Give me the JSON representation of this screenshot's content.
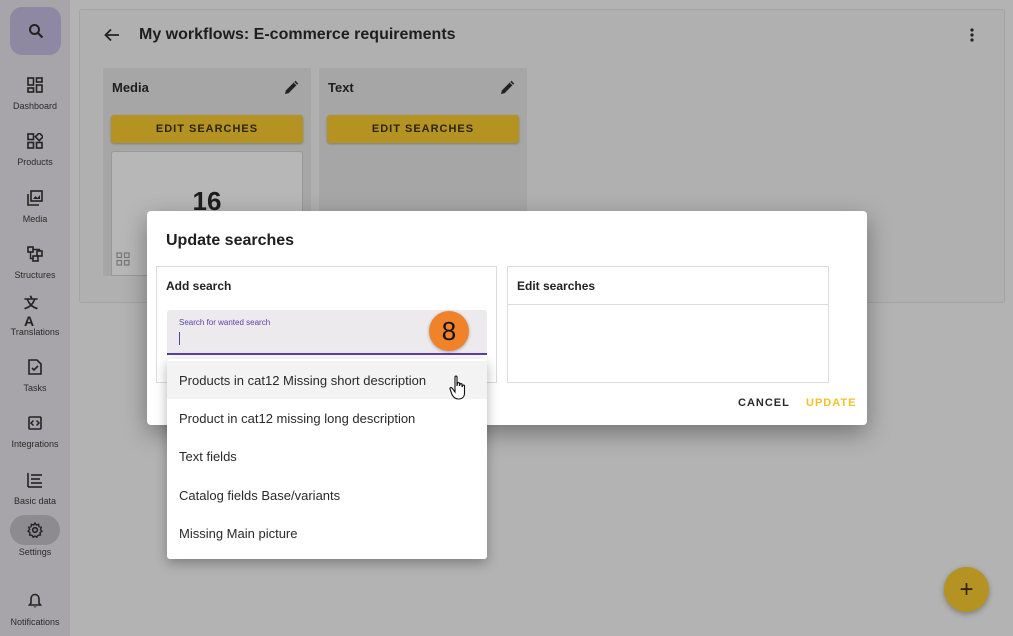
{
  "sidebar": {
    "items": [
      {
        "label": "Dashboard",
        "icon": "dashboard-icon"
      },
      {
        "label": "Products",
        "icon": "products-icon"
      },
      {
        "label": "Media",
        "icon": "media-icon"
      },
      {
        "label": "Structures",
        "icon": "structures-icon"
      },
      {
        "label": "Translations",
        "icon": "translate-icon"
      },
      {
        "label": "Tasks",
        "icon": "tasks-icon"
      },
      {
        "label": "Integrations",
        "icon": "integrations-icon"
      },
      {
        "label": "Basic data",
        "icon": "list-icon"
      },
      {
        "label": "Settings",
        "icon": "gear-icon"
      },
      {
        "label": "Notifications",
        "icon": "bell-icon"
      }
    ],
    "active": "Settings"
  },
  "header": {
    "title": "My workflows: E-commerce requirements"
  },
  "workflow_cards": [
    {
      "title": "Media",
      "button_label": "EDIT SEARCHES",
      "count": "16"
    },
    {
      "title": "Text",
      "button_label": "EDIT SEARCHES"
    }
  ],
  "dialog": {
    "title": "Update searches",
    "add_panel_title": "Add search",
    "edit_panel_title": "Edit searches",
    "search_placeholder": "Search for wanted search",
    "search_value": "",
    "cancel_label": "CANCEL",
    "update_label": "UPDATE"
  },
  "dropdown": {
    "options": [
      "Products in cat12 Missing short description",
      "Product in cat12 missing long description",
      "Text fields",
      "Catalog fields Base/variants",
      "Missing Main picture"
    ],
    "hovered_index": 0
  },
  "step_badge": "8",
  "fab_label": "+",
  "colors": {
    "accent": "#b49322",
    "update_text": "#f0c12a",
    "focus": "#5b3fa8",
    "badge": "#f0832a"
  }
}
